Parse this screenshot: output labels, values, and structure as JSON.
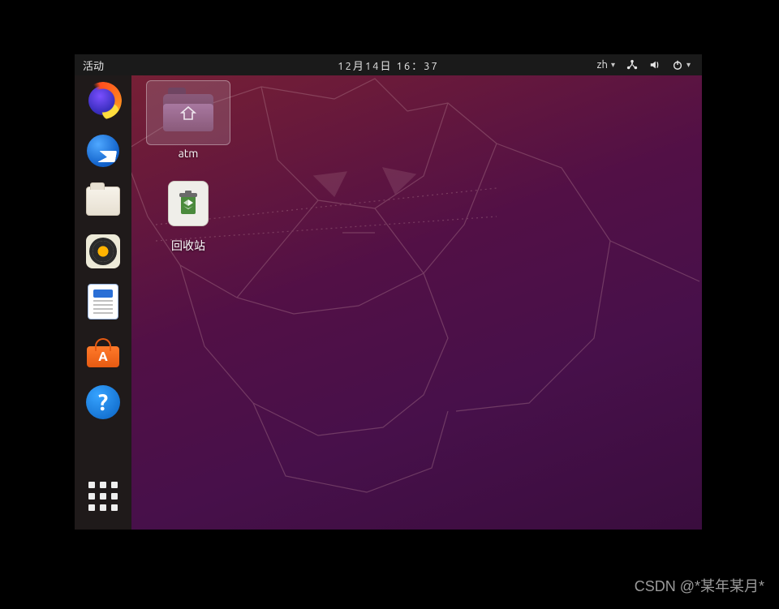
{
  "topbar": {
    "activities": "活动",
    "datetime": "12月14日  16：37",
    "input_method": "zh"
  },
  "dock": {
    "items": [
      {
        "name": "firefox"
      },
      {
        "name": "thunderbird"
      },
      {
        "name": "files"
      },
      {
        "name": "rhythmbox"
      },
      {
        "name": "libreoffice-writer"
      },
      {
        "name": "ubuntu-software"
      },
      {
        "name": "help"
      }
    ]
  },
  "desktop": {
    "icons": [
      {
        "name": "atm-folder",
        "label": "atm",
        "selected": true
      },
      {
        "name": "trash",
        "label": "回收站",
        "selected": false
      }
    ]
  },
  "watermark": "CSDN @*某年某月*"
}
